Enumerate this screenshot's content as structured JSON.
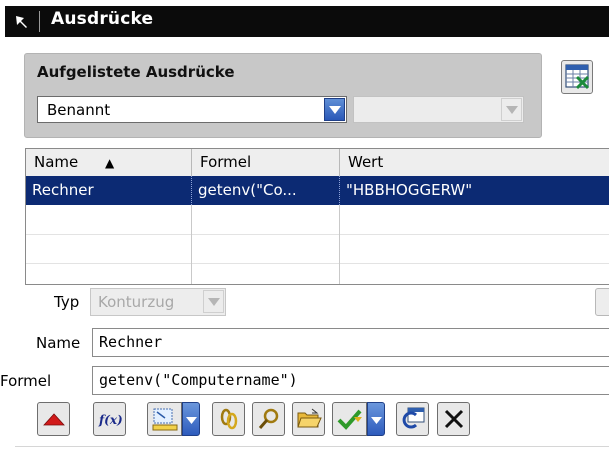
{
  "title_bar": {
    "title": "Ausdrücke",
    "pin_icon": "pin-icon"
  },
  "listed": {
    "label": "Aufgelistete Ausdrücke",
    "filter_value": "Benannt",
    "secondary_value": ""
  },
  "table": {
    "columns": [
      "Name",
      "Formel",
      "Wert"
    ],
    "sort_indicator": "▲",
    "rows": [
      {
        "name": "Rechner",
        "formula": "getenv(\"Co...",
        "value": "\"HBBHOGGERW\"",
        "selected": true
      }
    ]
  },
  "form": {
    "type_label": "Typ",
    "type_value": "Konturzug",
    "name_label": "Name",
    "name_value": "Rechner",
    "formula_label": "Formel",
    "formula_value": "getenv(\"Computername\")"
  },
  "toolbar": {
    "buttons": [
      "collapse-icon",
      "function-icon",
      "measure-icon",
      "link-icon",
      "find-icon",
      "open-folder-icon",
      "check-icon",
      "spreadsheet-edit-icon",
      "delete-icon"
    ]
  },
  "colors": {
    "title_bar": "#0b0b0b",
    "selection": "#0c2a73",
    "panel": "#c8c8c8",
    "dropdown_button": "#2a58b8"
  }
}
